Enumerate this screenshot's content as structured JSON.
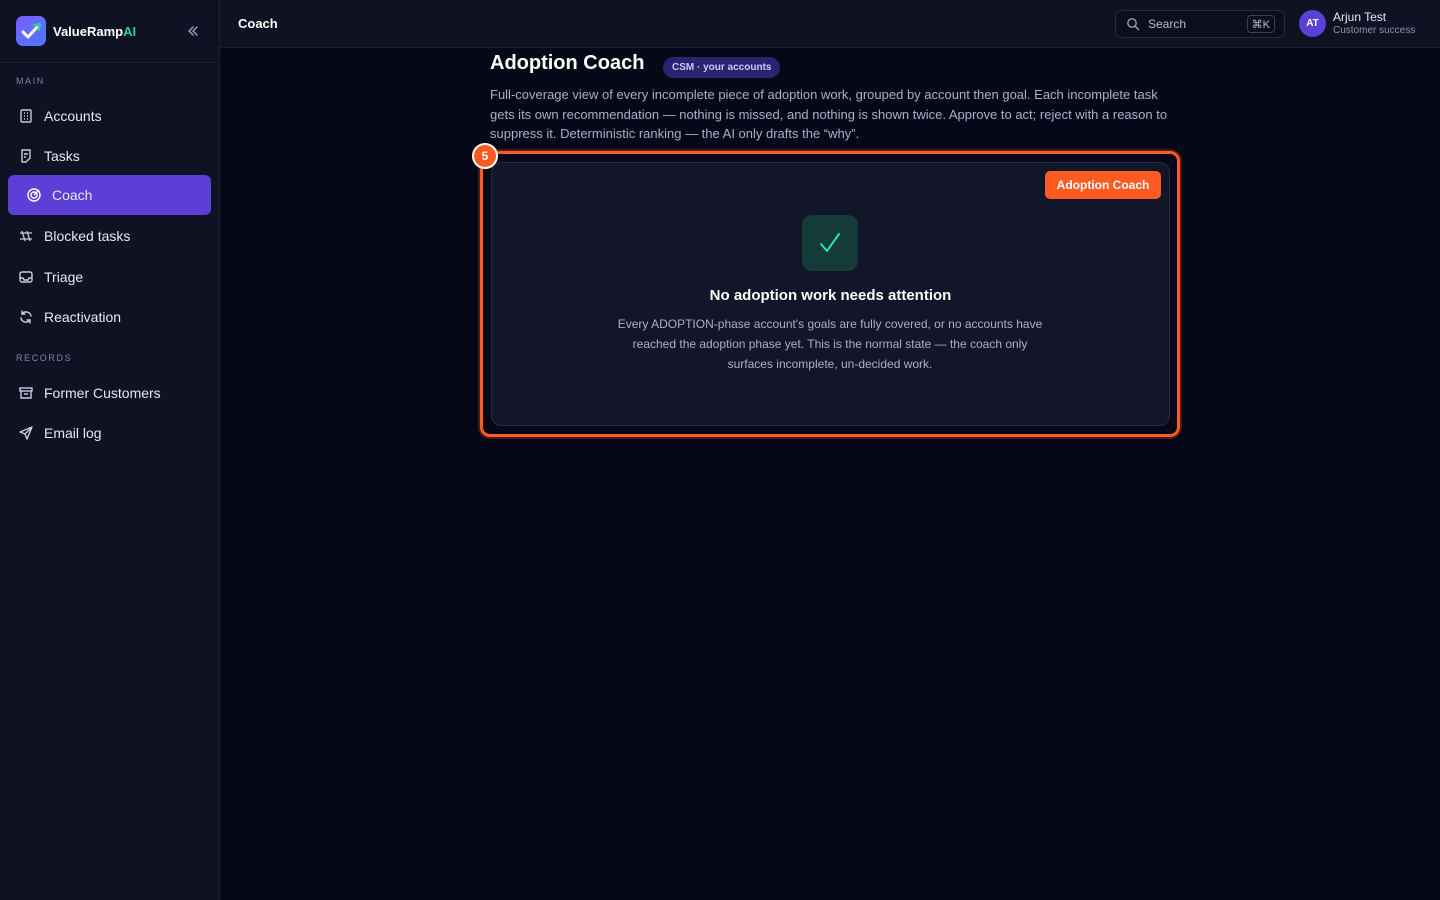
{
  "brand": {
    "name_main": "ValueRamp",
    "name_accent": "AI"
  },
  "sidebar": {
    "sections": [
      {
        "label": "MAIN"
      },
      {
        "label": "RECORDS"
      }
    ],
    "items": [
      {
        "label": "Accounts",
        "icon": "building-icon"
      },
      {
        "label": "Tasks",
        "icon": "task-icon"
      },
      {
        "label": "Coach",
        "icon": "target-icon",
        "active": true
      },
      {
        "label": "Blocked tasks",
        "icon": "blocked-icon"
      },
      {
        "label": "Triage",
        "icon": "inbox-icon"
      },
      {
        "label": "Reactivation",
        "icon": "refresh-icon"
      },
      {
        "label": "Former Customers",
        "icon": "archive-icon"
      },
      {
        "label": "Email log",
        "icon": "send-icon"
      }
    ]
  },
  "topbar": {
    "title": "Coach",
    "search": {
      "placeholder": "Search",
      "shortcut": "⌘K"
    },
    "user": {
      "initials": "AT",
      "name": "Arjun Test",
      "role": "Customer success"
    }
  },
  "main": {
    "title": "Adoption Coach",
    "badge": "CSM · your accounts",
    "description": "Full-coverage view of every incomplete piece of adoption work, grouped by account then goal. Each incomplete task gets its own recommendation — nothing is missed, and nothing is shown twice. Approve to act; reject with a reason to suppress it. Deterministic ranking — the AI only drafts the “why”.",
    "step_number": "5",
    "card": {
      "tag": "Adoption Coach",
      "check_icon": "check-icon",
      "empty_title": "No adoption work needs attention",
      "empty_description": "Every ADOPTION-phase account's goals are fully covered, or no accounts have reached the adoption phase yet. This is the normal state — the coach only surfaces incomplete, un-decided work."
    }
  },
  "colors": {
    "accent": "#5b3fd6",
    "highlight": "#ff5a1f",
    "success": "#2ee59d",
    "background": "#070817"
  }
}
